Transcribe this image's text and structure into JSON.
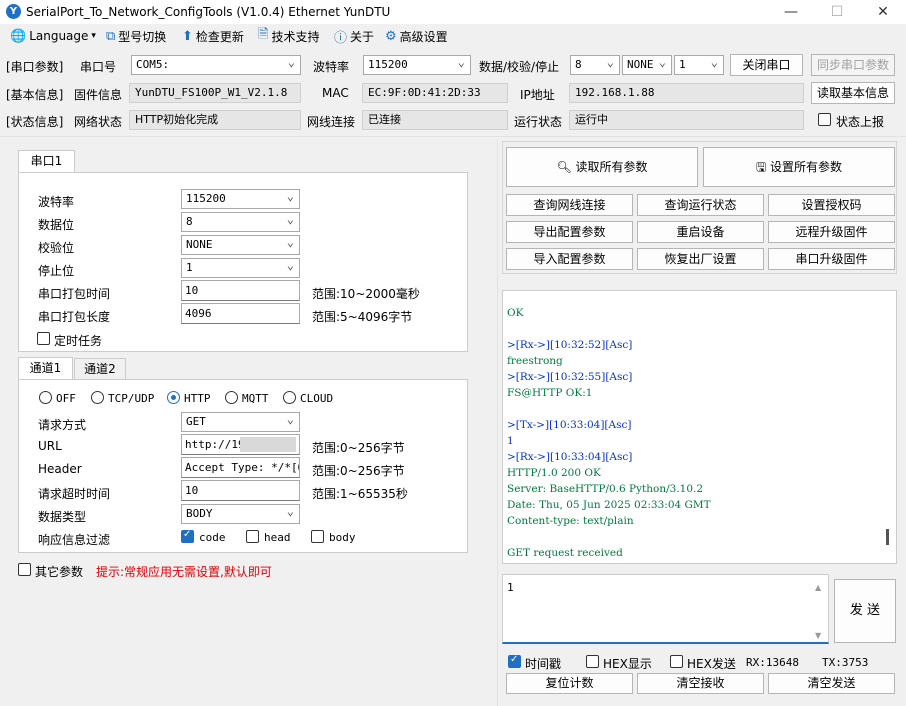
{
  "window": {
    "title": "SerialPort_To_Network_ConfigTools (V1.0.4) Ethernet YunDTU",
    "min": "—",
    "max": "☐",
    "close": "✕"
  },
  "menu": {
    "language": "Language",
    "model_switch": "型号切换",
    "check_update": "检查更新",
    "tech_support": "技术支持",
    "about": "关于",
    "advanced": "高级设置"
  },
  "serial_row": {
    "section": "[串口参数]",
    "port_label": "串口号",
    "port_value": "COM5:",
    "baud_label": "波特率",
    "baud_value": "115200",
    "dps_label": "数据/校验/停止",
    "data_bits": "8",
    "parity": "NONE",
    "stop_bits": "1",
    "close_port": "关闭串口",
    "sync_params": "同步串口参数"
  },
  "basic_row": {
    "section": "[基本信息]",
    "fw_label": "固件信息",
    "fw_value": "YunDTU_FS100P_W1_V2.1.8",
    "mac_label": "MAC",
    "mac_value": "EC:9F:0D:41:2D:33",
    "ip_label": "IP地址",
    "ip_value": "192.168.1.88",
    "read_basic": "读取基本信息"
  },
  "status_row": {
    "section": "[状态信息]",
    "net_label": "网络状态",
    "net_value": "HTTP初始化完成",
    "cable_label": "网线连接",
    "cable_value": "已连接",
    "run_label": "运行状态",
    "run_value": "运行中",
    "report_label": "状态上报"
  },
  "left": {
    "serial_tab": "串口1",
    "baud_label": "波特率",
    "baud_value": "115200",
    "data_label": "数据位",
    "data_value": "8",
    "parity_label": "校验位",
    "parity_value": "NONE",
    "stop_label": "停止位",
    "stop_value": "1",
    "pack_time_label": "串口打包时间",
    "pack_time_value": "10",
    "pack_time_range": "范围:10~2000毫秒",
    "pack_len_label": "串口打包长度",
    "pack_len_value": "4096",
    "pack_len_range": "范围:5~4096字节",
    "timer_label": "定时任务",
    "ch_tab1": "通道1",
    "ch_tab2": "通道2",
    "modes": [
      "OFF",
      "TCP/UDP",
      "HTTP",
      "MQTT",
      "CLOUD"
    ],
    "method_label": "请求方式",
    "method_value": "GET",
    "url_label": "URL",
    "url_value": "http://19",
    "url_range": "范围:0~256字节",
    "header_label": "Header",
    "header_value": "Accept Type: */*[OD",
    "header_range": "范围:0~256字节",
    "timeout_label": "请求超时时间",
    "timeout_value": "10",
    "timeout_range": "范围:1~65535秒",
    "dtype_label": "数据类型",
    "dtype_value": "BODY",
    "filter_label": "响应信息过滤",
    "filter_code": "code",
    "filter_head": "head",
    "filter_body": "body",
    "other_label": "其它参数",
    "hint": "提示:常规应用无需设置,默认即可"
  },
  "right": {
    "read_all": "读取所有参数",
    "set_all": "设置所有参数",
    "buttons": [
      "查询网线连接",
      "查询运行状态",
      "设置授权码",
      "导出配置参数",
      "重启设备",
      "远程升级固件",
      "导入配置参数",
      "恢复出厂设置",
      "串口升级固件"
    ],
    "log": [
      {
        "t": "OK",
        "c": "green"
      },
      {
        "t": "",
        "c": ""
      },
      {
        "t": ">[Rx->][10:32:52][Asc]",
        "c": "blue"
      },
      {
        "t": "freestrong",
        "c": "green"
      },
      {
        "t": ">[Rx->][10:32:55][Asc]",
        "c": "blue"
      },
      {
        "t": "FS@HTTP OK:1",
        "c": "green"
      },
      {
        "t": "",
        "c": ""
      },
      {
        "t": ">[Tx->][10:33:04][Asc]",
        "c": "blue"
      },
      {
        "t": "1",
        "c": "blue"
      },
      {
        "t": ">[Rx->][10:33:04][Asc]",
        "c": "blue"
      },
      {
        "t": "HTTP/1.0 200 OK",
        "c": "green"
      },
      {
        "t": "Server: BaseHTTP/0.6 Python/3.10.2",
        "c": "green"
      },
      {
        "t": "Date: Thu, 05 Jun 2025 02:33:04 GMT",
        "c": "green"
      },
      {
        "t": "Content-type: text/plain",
        "c": "green"
      },
      {
        "t": "",
        "c": ""
      },
      {
        "t": "GET request received",
        "c": "green"
      }
    ],
    "send_text": "1",
    "send_btn": "发 送",
    "timestamp_label": "时间戳",
    "hex_show_label": "HEX显示",
    "hex_send_label": "HEX发送",
    "rx": "RX:13648",
    "tx": "TX:3753",
    "reset_count": "复位计数",
    "clear_rx": "清空接收",
    "clear_tx": "清空发送"
  }
}
